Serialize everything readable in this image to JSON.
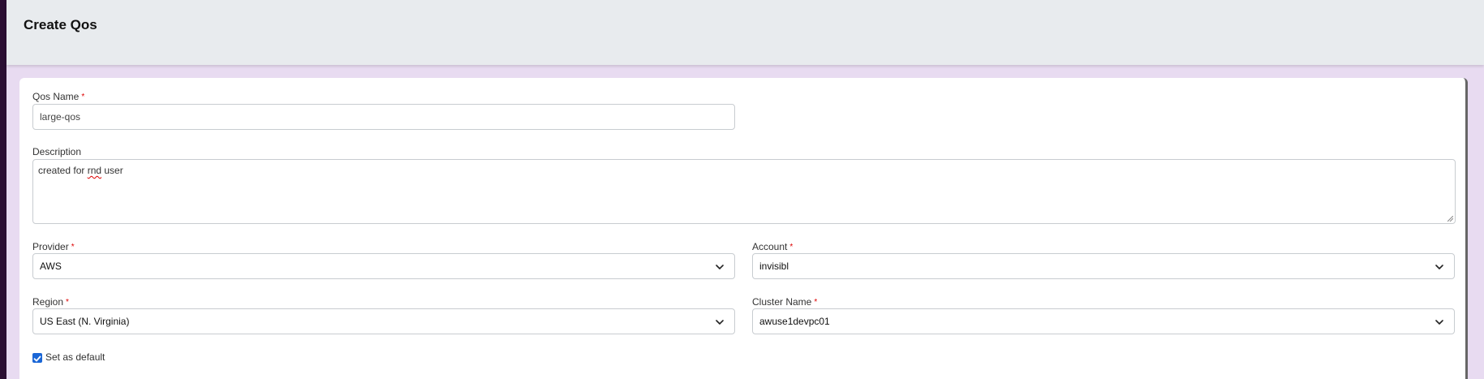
{
  "page_title": "Create Qos",
  "form": {
    "qos_name": {
      "label": "Qos Name",
      "required_mark": "*",
      "value": "large-qos"
    },
    "description": {
      "label": "Description",
      "value_prefix": "created for ",
      "value_misspelled": "rnd",
      "value_suffix": " user"
    },
    "provider": {
      "label": "Provider",
      "required_mark": "*",
      "selected": "AWS"
    },
    "account": {
      "label": "Account",
      "required_mark": "*",
      "selected": "invisibl"
    },
    "region": {
      "label": "Region",
      "required_mark": "*",
      "selected": "US East (N. Virginia)"
    },
    "cluster_name": {
      "label": "Cluster Name",
      "required_mark": "*",
      "selected": "awuse1devpc01"
    },
    "set_default": {
      "label": "Set as default",
      "checked": true
    }
  },
  "colors": {
    "accent": "#1a66d6",
    "required": "#dd0000",
    "header_bg": "#e8ebee",
    "page_bg": "#e8dbf1",
    "rail": "#2b0f33"
  }
}
